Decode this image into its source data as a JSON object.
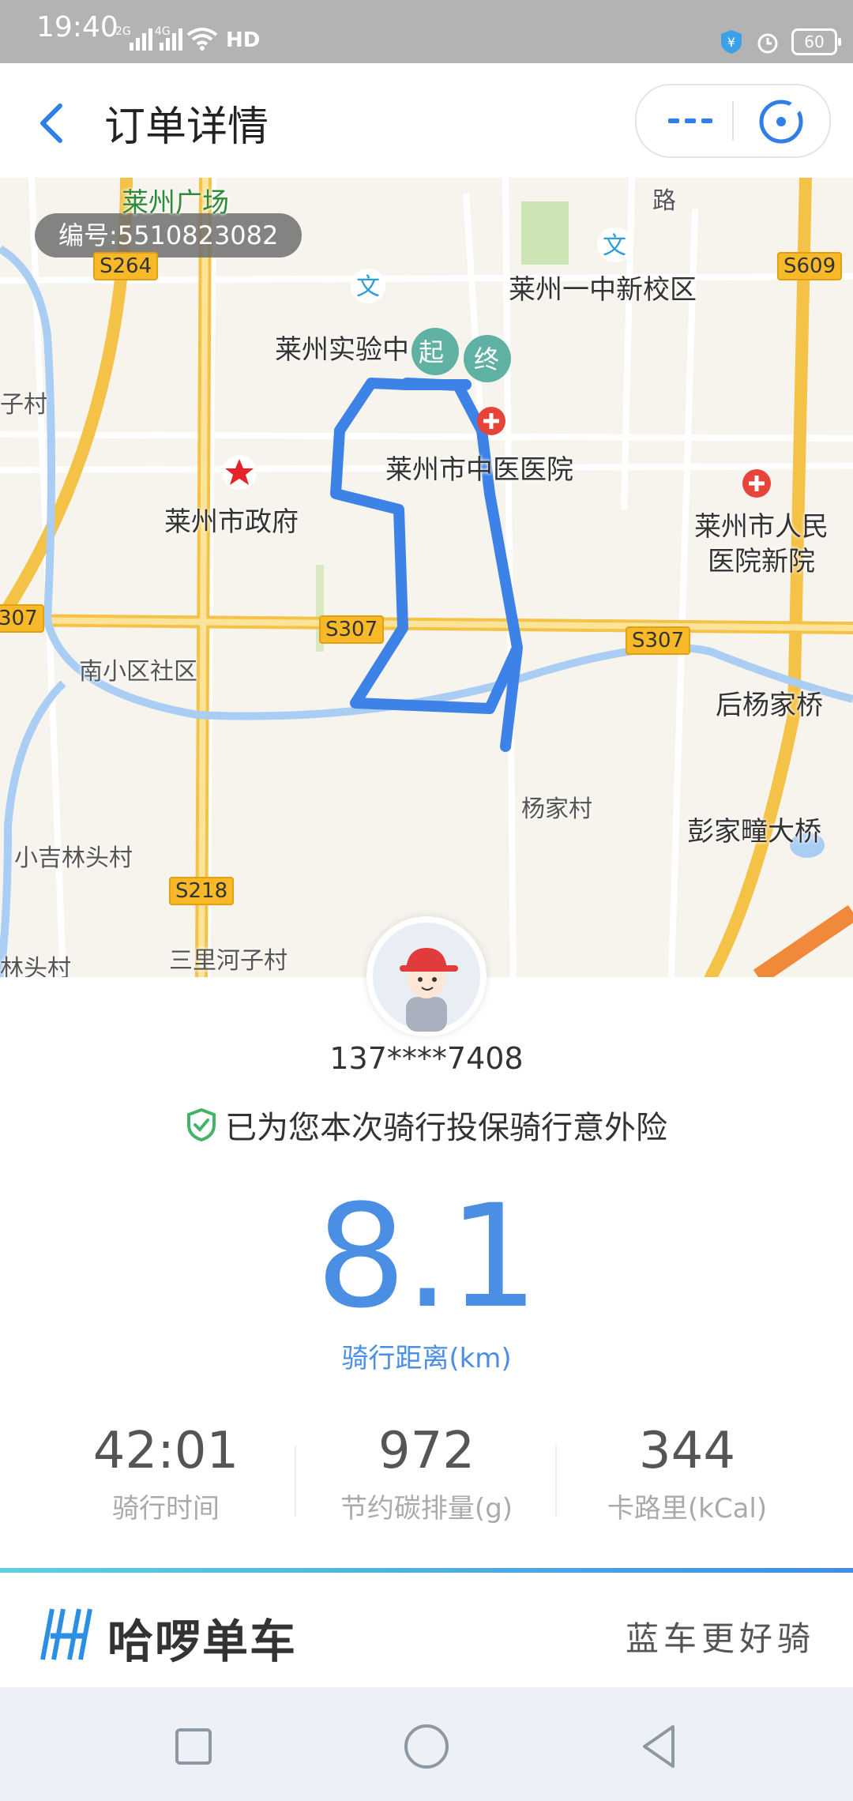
{
  "status_bar": {
    "time": "19:40",
    "net1": "2G",
    "net2": "4G",
    "hd": "HD",
    "battery": "60"
  },
  "header": {
    "title": "订单详情"
  },
  "map": {
    "order_number": "编号:5510823082",
    "labels": {
      "laizhou_square": "莱州广场",
      "road": "路",
      "no1_school": "莱州一中新校区",
      "experimental": "莱州实验中",
      "village_left": "子村",
      "chinese_hospital": "莱州市中医医院",
      "gov": "莱州市政府",
      "peoples_hospital": "莱州市人民医院新院",
      "nanxiao": "南小区社区",
      "houyang_bridge": "后杨家桥",
      "yangjia": "杨家村",
      "pengjia_bridge": "彭家疃大桥",
      "xiaojilin": "小吉林头村",
      "sanlihe": "三里河子村",
      "lintou": "林头村"
    },
    "roads": {
      "s264": "S264",
      "s609": "S609",
      "s307a": "307",
      "s307b": "S307",
      "s307c": "S307",
      "s218": "S218"
    },
    "start_marker": "起",
    "end_marker": "终"
  },
  "rider": {
    "phone": "137****7408",
    "insurance_text": "已为您本次骑行投保骑行意外险"
  },
  "trip": {
    "distance": "8.1",
    "distance_label": "骑行距离(km)",
    "stats": [
      {
        "value": "42:01",
        "label": "骑行时间"
      },
      {
        "value": "972",
        "label": "节约碳排量(g)"
      },
      {
        "value": "344",
        "label": "卡路里(kCal)"
      }
    ]
  },
  "brand": {
    "name": "哈啰单车",
    "slogan": "蓝车更好骑"
  },
  "colors": {
    "accent": "#4a8fe3",
    "route": "#3d82e6",
    "road_major": "#f7c74a"
  }
}
